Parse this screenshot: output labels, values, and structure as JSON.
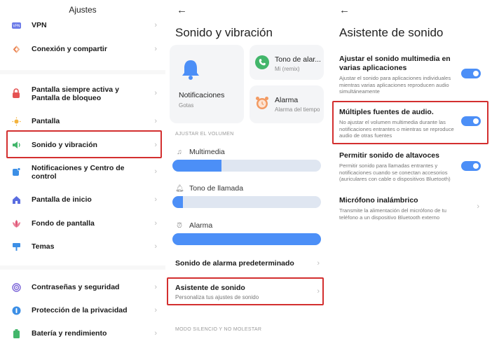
{
  "settings": {
    "title": "Ajustes",
    "items": [
      {
        "label": "VPN",
        "icon": "vpn-icon"
      },
      {
        "label": "Conexión y compartir",
        "icon": "connection-icon"
      },
      {
        "label": "Pantalla siempre activa y Pantalla de bloqueo",
        "icon": "lock-icon"
      },
      {
        "label": "Pantalla",
        "icon": "sun-icon"
      },
      {
        "label": "Sonido y vibración",
        "icon": "speaker-icon"
      },
      {
        "label": "Notificaciones y Centro de control",
        "icon": "notification-icon"
      },
      {
        "label": "Pantalla de inicio",
        "icon": "home-icon"
      },
      {
        "label": "Fondo de pantalla",
        "icon": "flower-icon"
      },
      {
        "label": "Temas",
        "icon": "brush-icon"
      },
      {
        "label": "Contraseñas y seguridad",
        "icon": "fingerprint-icon"
      },
      {
        "label": "Protección de la privacidad",
        "icon": "privacy-icon"
      },
      {
        "label": "Batería y rendimiento",
        "icon": "battery-icon"
      }
    ]
  },
  "sound": {
    "title": "Sonido y vibración",
    "cards": {
      "notifications": {
        "title": "Notificaciones",
        "sub": "Gotas"
      },
      "ringtone": {
        "title": "Tono de alar...",
        "sub": "Mi (remix)"
      },
      "alarm": {
        "title": "Alarma",
        "sub": "Alarma del tiempo"
      }
    },
    "volume_header": "AJUSTAR EL VOLUMEN",
    "volumes": [
      {
        "label": "Multimedia",
        "level": 0.33
      },
      {
        "label": "Tono de llamada",
        "level": 0.07
      },
      {
        "label": "Alarma",
        "level": 1.0
      }
    ],
    "default_alarm": "Sonido de alarma predeterminado",
    "assistant": {
      "title": "Asistente de sonido",
      "sub": "Personaliza tus ajustes de sonido"
    },
    "silent_header": "MODO SILENCIO Y NO MOLESTAR"
  },
  "assistant": {
    "title": "Asistente de sonido",
    "options": [
      {
        "title": "Ajustar el sonido multimedia en varias aplicaciones",
        "desc": "Ajustar el sonido para aplicaciones individuales mientras varias aplicaciones reproducen audio simultáneamente",
        "toggle": true
      },
      {
        "title": "Múltiples fuentes de audio.",
        "desc": "No ajustar el volumen multimedia durante las notificaciones entrantes o mientras se reproduce audio de otras fuentes",
        "toggle": true
      },
      {
        "title": "Permitir sonido de altavoces",
        "desc": "Permitir sonido para llamadas entrantes y notificaciones cuando se conectan accesorios (auriculares con cable o dispositivos Bluetooth)",
        "toggle": true
      },
      {
        "title": "Micrófono inalámbrico",
        "desc": "Transmite la alimentación del micrófono de tu teléfono a un dispositivo Bluetooth externo",
        "toggle": false
      }
    ]
  },
  "colors": {
    "accent": "#4c8ff7",
    "highlight": "#d32f2f"
  }
}
